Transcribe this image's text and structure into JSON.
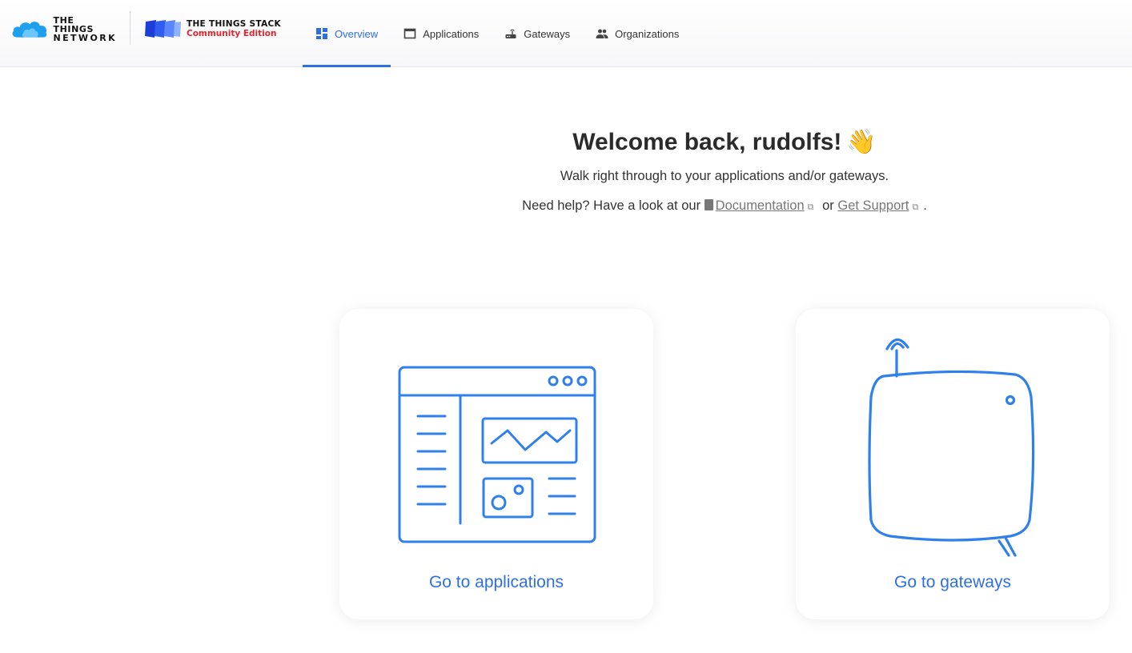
{
  "brand": {
    "ttn_line1": "THE THINGS",
    "ttn_line2": "NETWORK",
    "stack_line1": "THE THINGS STACK",
    "stack_line2": "Community Edition",
    "accent_color": "#2f6fe5",
    "edition_color": "#e3242b"
  },
  "nav": {
    "items": [
      {
        "label": "Overview",
        "icon": "dashboard-icon",
        "active": true
      },
      {
        "label": "Applications",
        "icon": "window-icon",
        "active": false
      },
      {
        "label": "Gateways",
        "icon": "router-icon",
        "active": false
      },
      {
        "label": "Organizations",
        "icon": "people-icon",
        "active": false
      }
    ]
  },
  "welcome": {
    "title": "Welcome back, rudolfs!",
    "emoji": "👋",
    "subtitle": "Walk right through to your applications and/or gateways.",
    "help_prefix": "Need help? Have a look at our",
    "doc_link": "Documentation",
    "or_text": "or",
    "support_link": "Get Support",
    "suffix": "."
  },
  "cards": {
    "applications": {
      "label": "Go to applications",
      "icon": "application-window-illustration"
    },
    "gateways": {
      "label": "Go to gateways",
      "icon": "gateway-device-illustration"
    }
  }
}
